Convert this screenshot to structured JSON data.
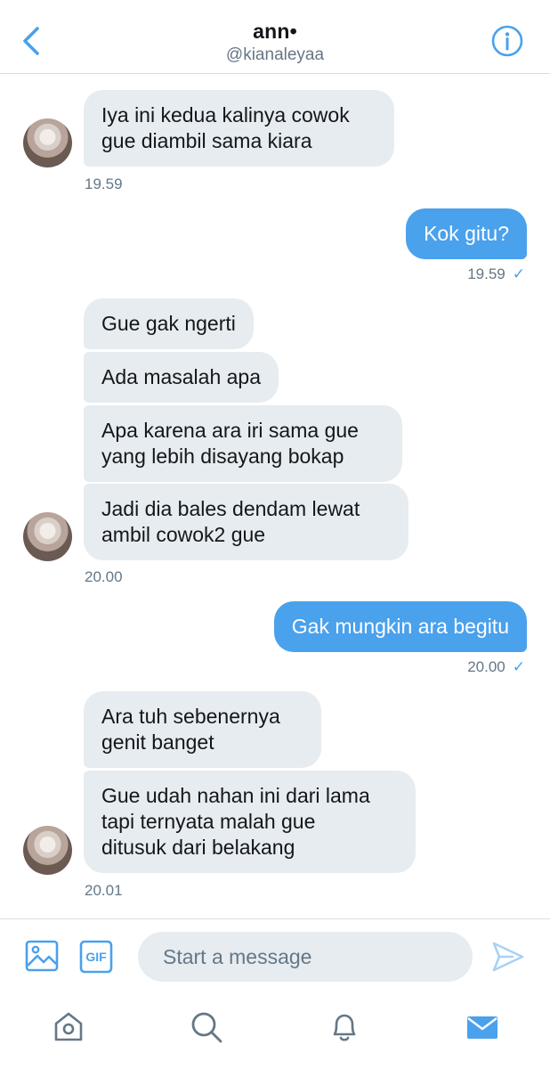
{
  "header": {
    "name": "ann•",
    "handle": "@kianaleyaa"
  },
  "messages": [
    {
      "from": "them",
      "text": "Iya ini kedua kalinya cowok\ngue diambil sama kiara"
    },
    {
      "time": "19.59"
    },
    {
      "from": "me",
      "text": "Kok gitu?"
    },
    {
      "time": "19.59"
    },
    {
      "from": "them",
      "text": "Gue gak ngerti"
    },
    {
      "from": "them",
      "text": "Ada masalah apa"
    },
    {
      "from": "them",
      "text": "Apa karena ara iri sama gue\nyang lebih disayang bokap"
    },
    {
      "from": "them",
      "text": "Jadi dia bales dendam lewat\nambil cowok2 gue"
    },
    {
      "time": "20.00"
    },
    {
      "from": "me",
      "text": "Gak mungkin ara begitu"
    },
    {
      "time": "20.00"
    },
    {
      "from": "them",
      "text": "Ara tuh sebenernya\ngenit banget"
    },
    {
      "from": "them",
      "text": "Gue udah nahan ini dari lama\ntapi ternyata malah gue\nditusuk dari belakang"
    },
    {
      "time": "20.01"
    }
  ],
  "chat": {
    "m1": "Iya ini kedua kalinya cowok\ngue diambil sama kiara",
    "t1": "19.59",
    "m2": "Kok gitu?",
    "t2": "19.59",
    "m3": "Gue gak ngerti",
    "m4": "Ada masalah apa",
    "m5": "Apa karena ara iri sama gue\nyang lebih disayang bokap",
    "m6": "Jadi dia bales dendam lewat\nambil cowok2 gue",
    "t3": "20.00",
    "m7": "Gak mungkin ara begitu",
    "t4": "20.00",
    "m8": "Ara tuh sebenernya\ngenit banget",
    "m9": "Gue udah nahan ini dari lama\ntapi ternyata malah gue\nditusuk dari belakang",
    "t5": "20.01",
    "read_mark": "✓"
  },
  "compose": {
    "placeholder": "Start a message",
    "gif_label": "GIF"
  },
  "icons": {
    "back": "chevron-left-icon",
    "info": "info-icon",
    "image": "image-icon",
    "gif": "gif-icon",
    "send": "send-icon",
    "home": "home-icon",
    "search": "search-icon",
    "notifications": "bell-icon",
    "messages": "mail-icon"
  },
  "colors": {
    "accent": "#4aa1ec",
    "incoming_bubble": "#e6ecf0",
    "muted_text": "#657786"
  },
  "tabs": {
    "active": "messages"
  }
}
